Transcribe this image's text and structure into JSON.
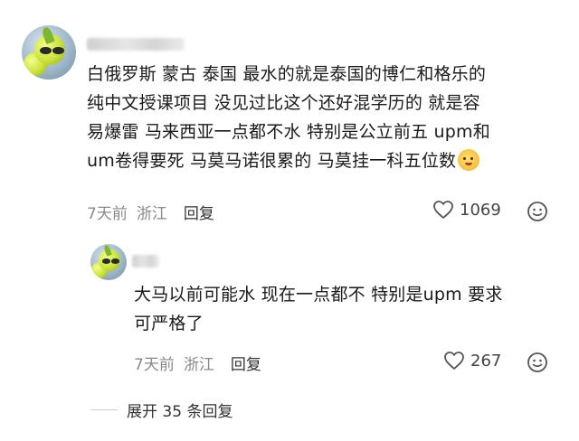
{
  "comment": {
    "lines": [
      "白俄罗斯 蒙古 泰国 最水的就是泰国的博仁和格乐的",
      "纯中文授课项目 没见过比这个还好混学历的 就是容",
      "易爆雷 马来西亚一点都不水 特别是公立前五 upm和",
      "um卷得要死 马莫马诺很累的 马莫挂一科五位数"
    ],
    "time": "7天前",
    "location": "浙江",
    "reply_label": "回复",
    "likes": "1069"
  },
  "reply": {
    "lines": [
      "大马以前可能水 现在一点都不 特别是upm 要求",
      "可严格了"
    ],
    "time": "7天前",
    "location": "浙江",
    "reply_label": "回复",
    "likes": "267"
  },
  "expand_label": "展开 35 条回复",
  "colors": {
    "meta": "#8a8a8a",
    "text": "#1a1a1a",
    "accent_ball": "#cbe23a"
  },
  "icons": [
    "heart-icon",
    "emoji-face-icon",
    "sticker-icon"
  ]
}
